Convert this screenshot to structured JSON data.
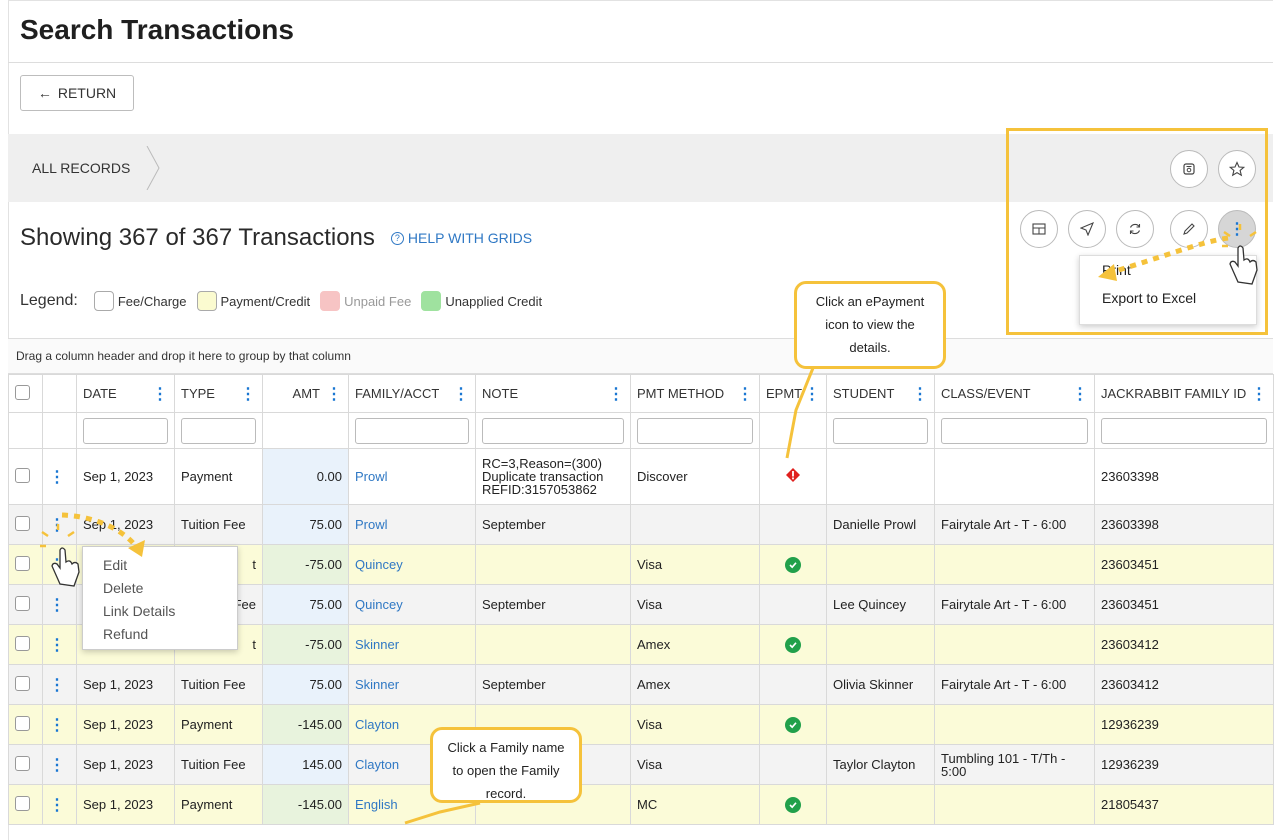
{
  "page": {
    "title": "Search Transactions",
    "return_label": "RETURN",
    "breadcrumb": "ALL RECORDS",
    "showing_text": "Showing 367 of 367 Transactions",
    "help_link": "HELP WITH GRIDS"
  },
  "legend": {
    "label": "Legend:",
    "items": [
      {
        "label": "Fee/Charge",
        "color": "#ffffff"
      },
      {
        "label": "Payment/Credit",
        "color": "#fbfbd0"
      },
      {
        "label": "Unpaid Fee",
        "color": "#f7c4c4"
      },
      {
        "label": "Unapplied Credit",
        "color": "#9fe29f"
      }
    ]
  },
  "toolbar": {
    "top_icons": [
      "save-icon",
      "star-icon"
    ],
    "icons": [
      "columns-icon",
      "send-icon",
      "refresh-icon",
      "pencil-icon",
      "more-vertical-icon"
    ],
    "menu": [
      "Print",
      "Export to Excel"
    ]
  },
  "grid": {
    "group_hint": "Drag a column header and drop it here to group by that column",
    "columns": [
      "DATE",
      "TYPE",
      "AMT",
      "FAMILY/ACCT",
      "NOTE",
      "PMT METHOD",
      "EPMT",
      "STUDENT",
      "CLASS/EVENT",
      "JACKRABBIT FAMILY ID"
    ],
    "rows": [
      {
        "date": "Sep 1, 2023",
        "type": "Payment",
        "amt": "0.00",
        "family": "Prowl",
        "note": "RC=3,Reason=(300) Duplicate transaction REFID:3157053862",
        "method": "Discover",
        "epmt": "error",
        "student": "",
        "class": "",
        "fid": "23603398"
      },
      {
        "date": "Sep 1, 2023",
        "type": "Tuition Fee",
        "amt": "75.00",
        "family": "Prowl",
        "note": "September",
        "method": "",
        "epmt": "",
        "student": "Danielle Prowl",
        "class": "Fairytale Art - T - 6:00",
        "fid": "23603398"
      },
      {
        "date": "",
        "type": "t",
        "amt": "-75.00",
        "family": "Quincey",
        "note": "",
        "method": "Visa",
        "epmt": "ok",
        "student": "",
        "class": "",
        "fid": "23603451"
      },
      {
        "date": "",
        "type": "Fee",
        "amt": "75.00",
        "family": "Quincey",
        "note": "September",
        "method": "Visa",
        "epmt": "",
        "student": "Lee Quincey",
        "class": "Fairytale Art - T - 6:00",
        "fid": "23603451"
      },
      {
        "date": "",
        "type": "t",
        "amt": "-75.00",
        "family": "Skinner",
        "note": "",
        "method": "Amex",
        "epmt": "ok",
        "student": "",
        "class": "",
        "fid": "23603412"
      },
      {
        "date": "Sep 1, 2023",
        "type": "Tuition Fee",
        "amt": "75.00",
        "family": "Skinner",
        "note": "September",
        "method": "Amex",
        "epmt": "",
        "student": "Olivia Skinner",
        "class": "Fairytale Art - T - 6:00",
        "fid": "23603412"
      },
      {
        "date": "Sep 1, 2023",
        "type": "Payment",
        "amt": "-145.00",
        "family": "Clayton",
        "note": "",
        "method": "Visa",
        "epmt": "ok",
        "student": "",
        "class": "",
        "fid": "12936239"
      },
      {
        "date": "Sep 1, 2023",
        "type": "Tuition Fee",
        "amt": "145.00",
        "family": "Clayton",
        "note": "",
        "method": "Visa",
        "epmt": "",
        "student": "Taylor Clayton",
        "class": "Tumbling 101 - T/Th - 5:00",
        "fid": "12936239"
      },
      {
        "date": "Sep 1, 2023",
        "type": "Payment",
        "amt": "-145.00",
        "family": "English",
        "note": "",
        "method": "MC",
        "epmt": "ok",
        "student": "",
        "class": "",
        "fid": "21805437"
      }
    ]
  },
  "row_menu": [
    "Edit",
    "Delete",
    "Link Details",
    "Refund"
  ],
  "callouts": {
    "epayment": "Click an ePayment icon to view the details.",
    "family": "Click a Family name to open the Family record."
  }
}
